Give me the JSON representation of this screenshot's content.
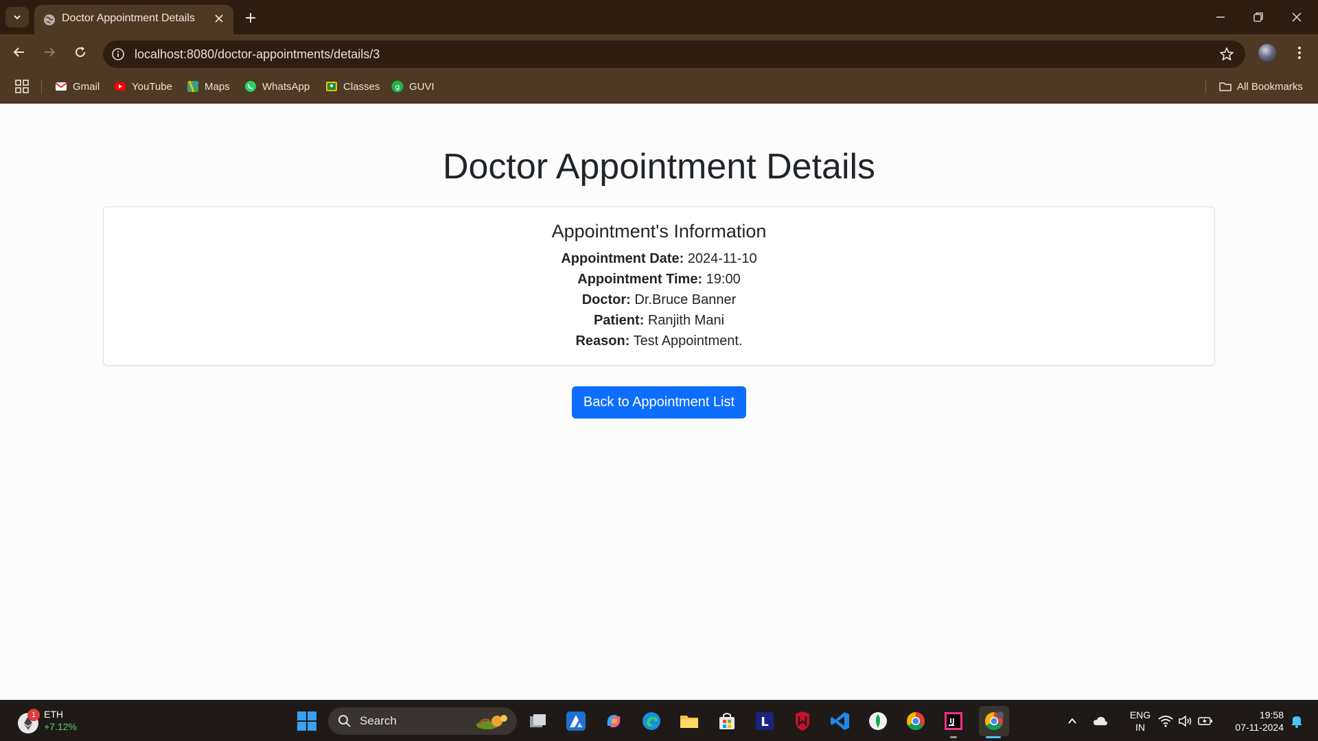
{
  "browser": {
    "tab_title": "Doctor Appointment Details",
    "url": "localhost:8080/doctor-appointments/details/3",
    "bookmarks": [
      {
        "label": "Gmail",
        "icon": "gmail-icon"
      },
      {
        "label": "YouTube",
        "icon": "youtube-icon"
      },
      {
        "label": "Maps",
        "icon": "maps-icon"
      },
      {
        "label": "WhatsApp",
        "icon": "whatsapp-icon"
      },
      {
        "label": "Classes",
        "icon": "classes-icon"
      },
      {
        "label": "GUVI",
        "icon": "guvi-icon"
      }
    ],
    "all_bookmarks_label": "All Bookmarks"
  },
  "page": {
    "title": "Doctor Appointment Details",
    "card_title": "Appointment's Information",
    "fields": [
      {
        "label": "Appointment Date:",
        "value": "2024-11-10"
      },
      {
        "label": "Appointment Time:",
        "value": "19:00"
      },
      {
        "label": "Doctor:",
        "value": "Dr.Bruce Banner"
      },
      {
        "label": "Patient:",
        "value": "Ranjith Mani"
      },
      {
        "label": "Reason:",
        "value": "Test Appointment."
      }
    ],
    "back_button_label": "Back to Appointment List"
  },
  "taskbar": {
    "widget": {
      "badge": "1",
      "name": "ETH",
      "change": "+7.12%"
    },
    "search_label": "Search",
    "language": {
      "line1": "ENG",
      "line2": "IN"
    },
    "clock": {
      "time": "19:58",
      "date": "07-11-2024"
    }
  },
  "colors": {
    "chrome_dark": "#2c1d10",
    "chrome_mid": "#4e3925",
    "primary_button": "#0d6efd",
    "text_dark": "#212529"
  }
}
